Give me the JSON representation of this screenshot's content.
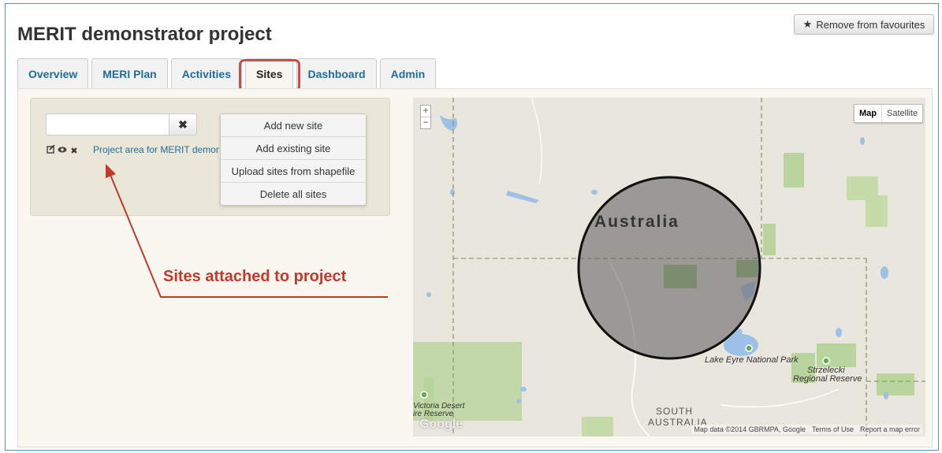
{
  "page": {
    "title": "MERIT demonstrator project",
    "favourite_label": "Remove from favourites"
  },
  "tabs": [
    {
      "label": "Overview"
    },
    {
      "label": "MERI Plan"
    },
    {
      "label": "Activities"
    },
    {
      "label": "Sites",
      "active": true
    },
    {
      "label": "Dashboard"
    },
    {
      "label": "Admin"
    }
  ],
  "sites_panel": {
    "search_value": "",
    "clear_label": "✖",
    "site_row": {
      "icons": [
        "edit-icon",
        "view-icon",
        "delete-icon"
      ],
      "link": "Project area for MERIT demonstrator project"
    },
    "menu": [
      {
        "label": "Add new site"
      },
      {
        "label": "Add existing site"
      },
      {
        "label": "Upload sites from shapefile"
      },
      {
        "label": "Delete all sites"
      }
    ]
  },
  "annotation": {
    "text": "Sites attached to project",
    "color": "#c0392b"
  },
  "map": {
    "zoom_in": "+",
    "zoom_out": "−",
    "type_map": "Map",
    "type_satellite": "Satellite",
    "region_label": "Australia",
    "south_label": "SOUTH",
    "australia_label": "AUSTRALIA",
    "lake_eyre": "Lake Eyre National Park",
    "strzelecki_1": "Strzelecki",
    "strzelecki_2": "Regional Reserve",
    "victoria_1": "Victoria Desert",
    "victoria_2": "ire Reserve",
    "google": "Google",
    "attribution": "Map data ©2014 GBRMPA, Google",
    "terms": "Terms of Use",
    "report": "Report a map error"
  },
  "colors": {
    "accent": "#1f6d9c",
    "highlight": "#c0504d",
    "panel": "#ebe7d8"
  }
}
